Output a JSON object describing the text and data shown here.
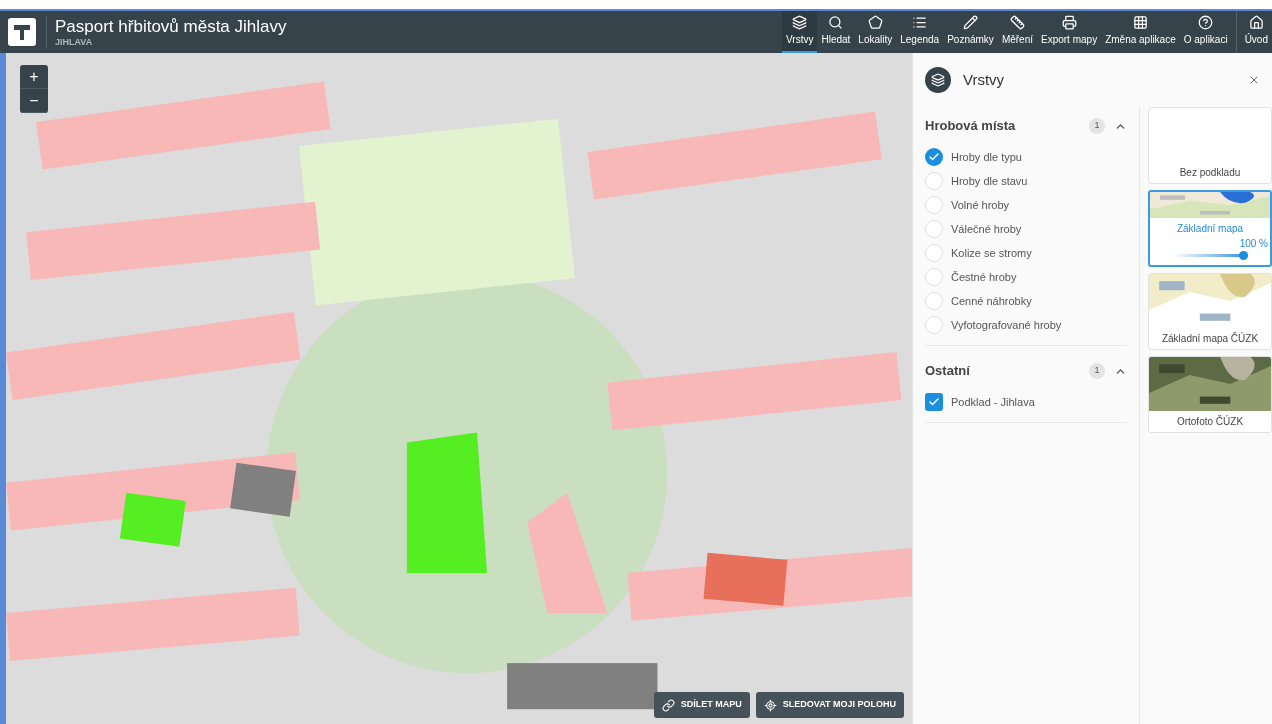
{
  "header": {
    "title": "Pasport hřbitovů města Jihlavy",
    "subtitle": "JIHLAVA"
  },
  "tools": [
    {
      "label": "Vrstvy",
      "selected": true
    },
    {
      "label": "Hledat",
      "selected": false
    },
    {
      "label": "Lokality",
      "selected": false
    },
    {
      "label": "Legenda",
      "selected": false
    },
    {
      "label": "Poznámky",
      "selected": false
    },
    {
      "label": "Měření",
      "selected": false
    },
    {
      "label": "Export mapy",
      "selected": false
    },
    {
      "label": "Změna aplikace",
      "selected": false
    },
    {
      "label": "O aplikaci",
      "selected": false
    },
    {
      "label": "Úvod",
      "selected": false
    }
  ],
  "map": {
    "zoom": [
      "+",
      "−"
    ],
    "actions": [
      "SDÍLET MAPU",
      "SLEDOVAT MOJI POLOHU"
    ]
  },
  "panel": {
    "title": "Vrstvy",
    "groups": [
      {
        "title": "Hrobová místa",
        "count": "1",
        "expanded": true,
        "items": [
          {
            "label": "Hroby dle typu",
            "kind": "radio",
            "checked": true
          },
          {
            "label": "Hroby dle stavu",
            "kind": "radio",
            "checked": false
          },
          {
            "label": "Volné hroby",
            "kind": "radio",
            "checked": false
          },
          {
            "label": "Válečné hroby",
            "kind": "radio",
            "checked": false
          },
          {
            "label": "Kolize se stromy",
            "kind": "radio",
            "checked": false
          },
          {
            "label": "Čestné hroby",
            "kind": "radio",
            "checked": false
          },
          {
            "label": "Cenné náhrobky",
            "kind": "radio",
            "checked": false
          },
          {
            "label": "Vyfotografované hroby",
            "kind": "radio",
            "checked": false
          }
        ]
      },
      {
        "title": "Ostatní",
        "count": "1",
        "expanded": true,
        "items": [
          {
            "label": "Podklad - Jihlava",
            "kind": "checkbox",
            "checked": true
          }
        ]
      }
    ],
    "basemaps": [
      {
        "label": "Bez podkladu",
        "kind": "empty",
        "selected": false
      },
      {
        "label": "Základní mapa",
        "kind": "picture",
        "selected": true,
        "level": 1,
        "reading": "100 %"
      },
      {
        "label": "Základní mapa ČÚZK",
        "kind": "picture",
        "selected": false
      },
      {
        "label": "Ortofoto ČÚZK",
        "kind": "picture",
        "selected": false
      }
    ]
  }
}
